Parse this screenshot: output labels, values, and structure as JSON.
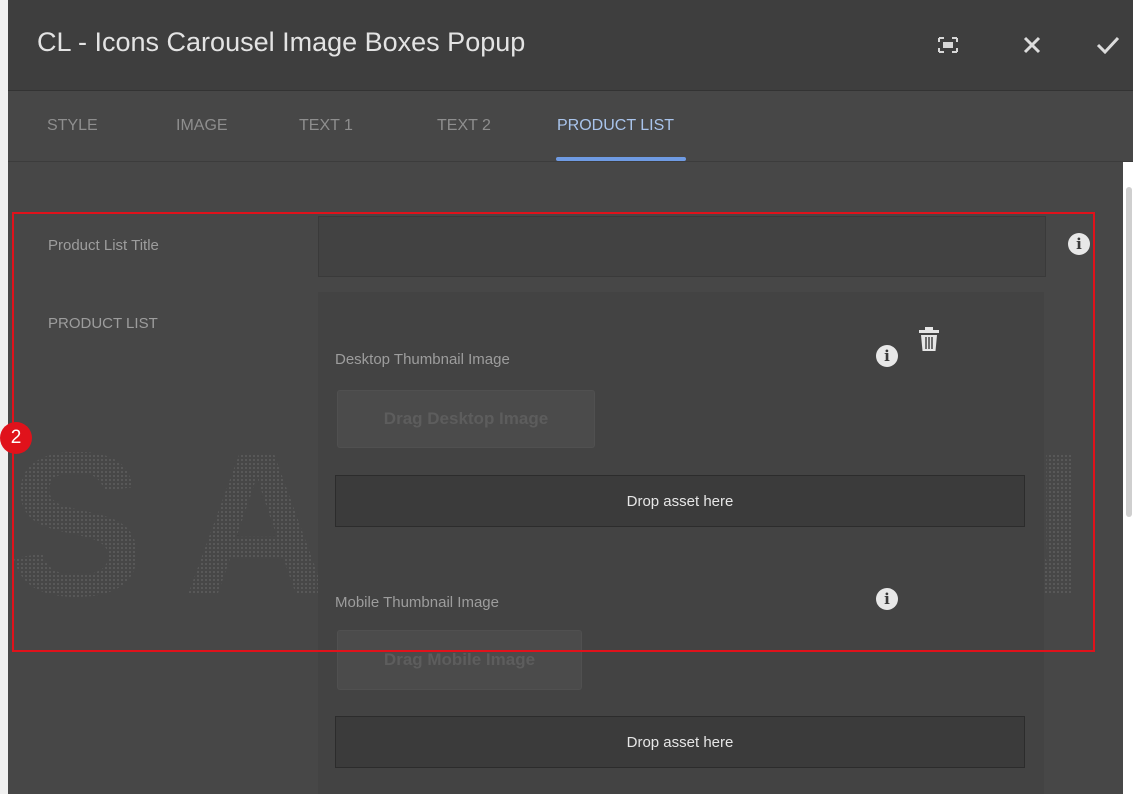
{
  "dialog": {
    "title": "CL - Icons Carousel Image Boxes Popup",
    "actions": [
      "fullscreen-icon",
      "close-icon",
      "checkmark-icon"
    ]
  },
  "tabs": [
    {
      "label": "STYLE",
      "active": false
    },
    {
      "label": "IMAGE",
      "active": false
    },
    {
      "label": "TEXT 1",
      "active": false
    },
    {
      "label": "TEXT 2",
      "active": false
    },
    {
      "label": "PRODUCT LIST",
      "active": true
    }
  ],
  "form": {
    "title_label": "Product List Title",
    "title_value": "",
    "list_label": "PRODUCT LIST",
    "desktop": {
      "label": "Desktop Thumbnail Image",
      "drag_button": "Drag Desktop Image",
      "drop_text": "Drop asset here"
    },
    "mobile": {
      "label": "Mobile Thumbnail Image",
      "drag_button": "Drag Mobile Image",
      "drop_text": "Drop asset here"
    }
  },
  "annotation": {
    "badge": "2",
    "color": "#e0121b"
  },
  "watermark": "SAMSUNG",
  "colors": {
    "accent": "#6f9be3",
    "active_tab": "#a9c4ec"
  }
}
